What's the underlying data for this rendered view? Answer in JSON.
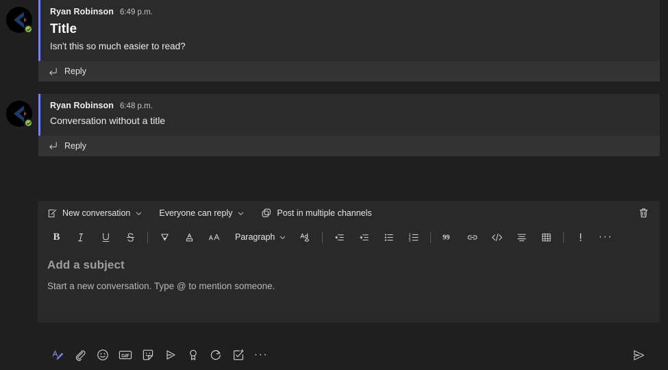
{
  "theme": {
    "page_bg": "#1f1f1f",
    "message_bg": "#2b2b2b",
    "reply_bg": "#333333",
    "composer_bg": "#292929",
    "accent_bar": "#7b83eb",
    "presence_available": "#92c353",
    "format_active": "#7b83eb"
  },
  "messages": [
    {
      "author": "Ryan Robinson",
      "timestamp": "6:49 p.m.",
      "title": "Title",
      "text": "Isn't this so much easier to read?",
      "reply_label": "Reply",
      "presence": "available"
    },
    {
      "author": "Ryan Robinson",
      "timestamp": "6:48 p.m.",
      "title": "",
      "text": "Conversation without a title",
      "reply_label": "Reply",
      "presence": "available"
    }
  ],
  "composer": {
    "options": [
      {
        "icon": "compose-icon",
        "label": "New conversation",
        "has_chevron": true
      },
      {
        "icon": "",
        "label": "Everyone can reply",
        "has_chevron": true
      },
      {
        "icon": "copy-channels-icon",
        "label": "Post in multiple channels",
        "has_chevron": false
      }
    ],
    "delete_icon": "trash-icon",
    "format_buttons": [
      {
        "name": "bold-button",
        "label": "B"
      },
      {
        "name": "italic-button",
        "label": "I"
      },
      {
        "name": "underline-button",
        "label": "U"
      },
      {
        "name": "strikethrough-button",
        "label": "S"
      },
      {
        "name": "highlight-color-button",
        "label": ""
      },
      {
        "name": "font-color-button",
        "label": ""
      },
      {
        "name": "font-size-button",
        "label": ""
      },
      {
        "name": "paragraph-style-dropdown",
        "label": "Paragraph"
      },
      {
        "name": "clear-formatting-button",
        "label": ""
      },
      {
        "name": "decrease-indent-button",
        "label": ""
      },
      {
        "name": "increase-indent-button",
        "label": ""
      },
      {
        "name": "bulleted-list-button",
        "label": ""
      },
      {
        "name": "numbered-list-button",
        "label": ""
      },
      {
        "name": "quote-button",
        "label": ""
      },
      {
        "name": "insert-link-button",
        "label": ""
      },
      {
        "name": "code-block-button",
        "label": ""
      },
      {
        "name": "align-button",
        "label": ""
      },
      {
        "name": "insert-table-button",
        "label": ""
      },
      {
        "name": "important-button",
        "label": ""
      },
      {
        "name": "more-formatting-button",
        "label": ""
      }
    ],
    "paragraph_label": "Paragraph",
    "subject_placeholder": "Add a subject",
    "body_placeholder": "Start a new conversation. Type @ to mention someone.",
    "bottom_actions": [
      {
        "name": "format-button",
        "icon": "format-pen-icon",
        "active": true
      },
      {
        "name": "attach-file-button",
        "icon": "paperclip-icon",
        "active": false
      },
      {
        "name": "emoji-button",
        "icon": "emoji-icon",
        "active": false
      },
      {
        "name": "giphy-button",
        "icon": "gif-icon",
        "active": false
      },
      {
        "name": "sticker-button",
        "icon": "sticker-icon",
        "active": false
      },
      {
        "name": "stream-video-button",
        "icon": "play-outline-icon",
        "active": false
      },
      {
        "name": "praise-button",
        "icon": "praise-badge-icon",
        "active": false
      },
      {
        "name": "loop-component-button",
        "icon": "loop-refresh-icon",
        "active": false
      },
      {
        "name": "tasks-button",
        "icon": "task-add-icon",
        "active": false
      },
      {
        "name": "more-options-button",
        "icon": "ellipsis-icon",
        "active": false
      }
    ],
    "send_icon": "send-icon",
    "gif_label": "GIF"
  }
}
